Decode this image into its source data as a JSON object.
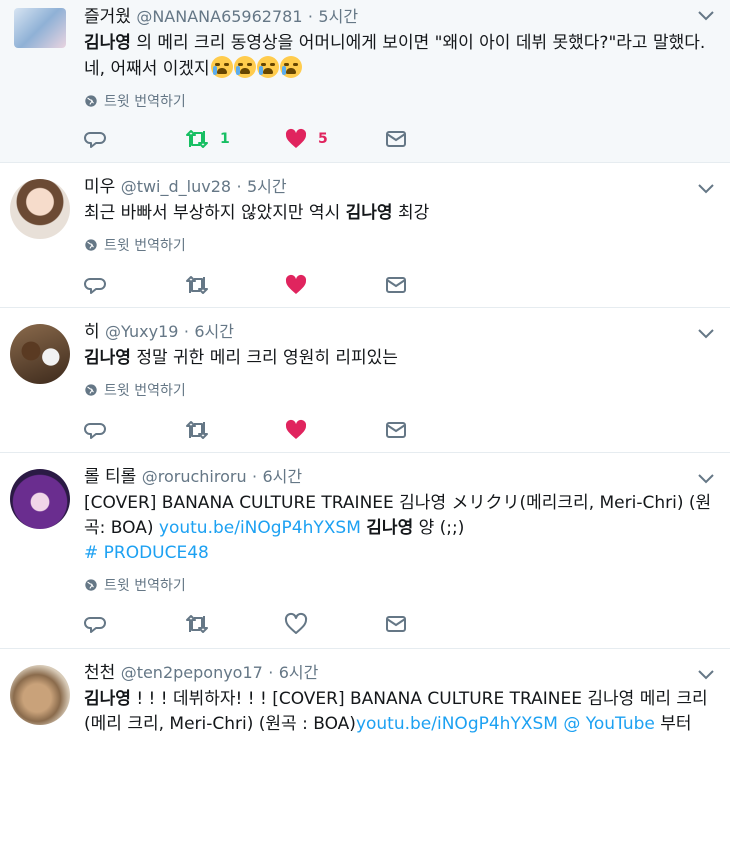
{
  "tweets": [
    {
      "name": "즐거웠",
      "handle": "@NANANA65962781",
      "time": "5시간",
      "text_parts": [
        "김나영",
        " 의 메리 크리 동영상을 어머니에게 보이면 \"왜이 아이 데뷔 못했다?\"라고 말했다. 네, 어째서 이겠지"
      ],
      "translate": "트윗 번역하기",
      "retweets": "1",
      "likes": "5"
    },
    {
      "name": "미우",
      "handle": "@twi_d_luv28",
      "time": "5시간",
      "text_parts": [
        "최근 바빠서 부상하지 않았지만 역시 ",
        "김나영",
        " 최강"
      ],
      "translate": "트윗 번역하기"
    },
    {
      "name": "히",
      "handle": "@Yuxy19",
      "time": "6시간",
      "text_parts": [
        "김나영",
        " 정말 귀한 메리 크리 영원히 리피있는"
      ],
      "translate": "트윗 번역하기"
    },
    {
      "name": "롤 티롤",
      "handle": "@roruchiroru",
      "time": "6시간",
      "text_parts": [
        "[COVER] BANANA CULTURE TRAINEE 김나영 メリクリ(메리크리, Meri-Chri) (원곡: BOA) ",
        "youtu.be/iNOgP4hYXSM",
        " ",
        "김나영",
        " 양 (;;)"
      ],
      "hashtag": "# PRODUCE48",
      "translate": "트윗 번역하기"
    },
    {
      "name": "천천",
      "handle": "@ten2peponyo17",
      "time": "6시간",
      "text_parts": [
        "김나영",
        " ! ! ! 데뷔하자! ! ! [COVER] BANANA CULTURE TRAINEE 김나영 메리 크리 (메리 크리, Meri-Chri) (원곡 : BOA)",
        "youtu.be/iNOgP4hYXSM @ YouTube",
        " 부터"
      ]
    }
  ],
  "separator": "·",
  "colors": {
    "retweet_active": "#17bf63",
    "like_active": "#e0245e",
    "icon": "#657786",
    "link": "#1da1f2"
  },
  "icons": [
    "reply-icon",
    "retweet-icon",
    "heart-icon",
    "dm-envelope-icon",
    "globe-icon",
    "chevron-down-icon",
    "loudly-crying-face-emoji"
  ]
}
